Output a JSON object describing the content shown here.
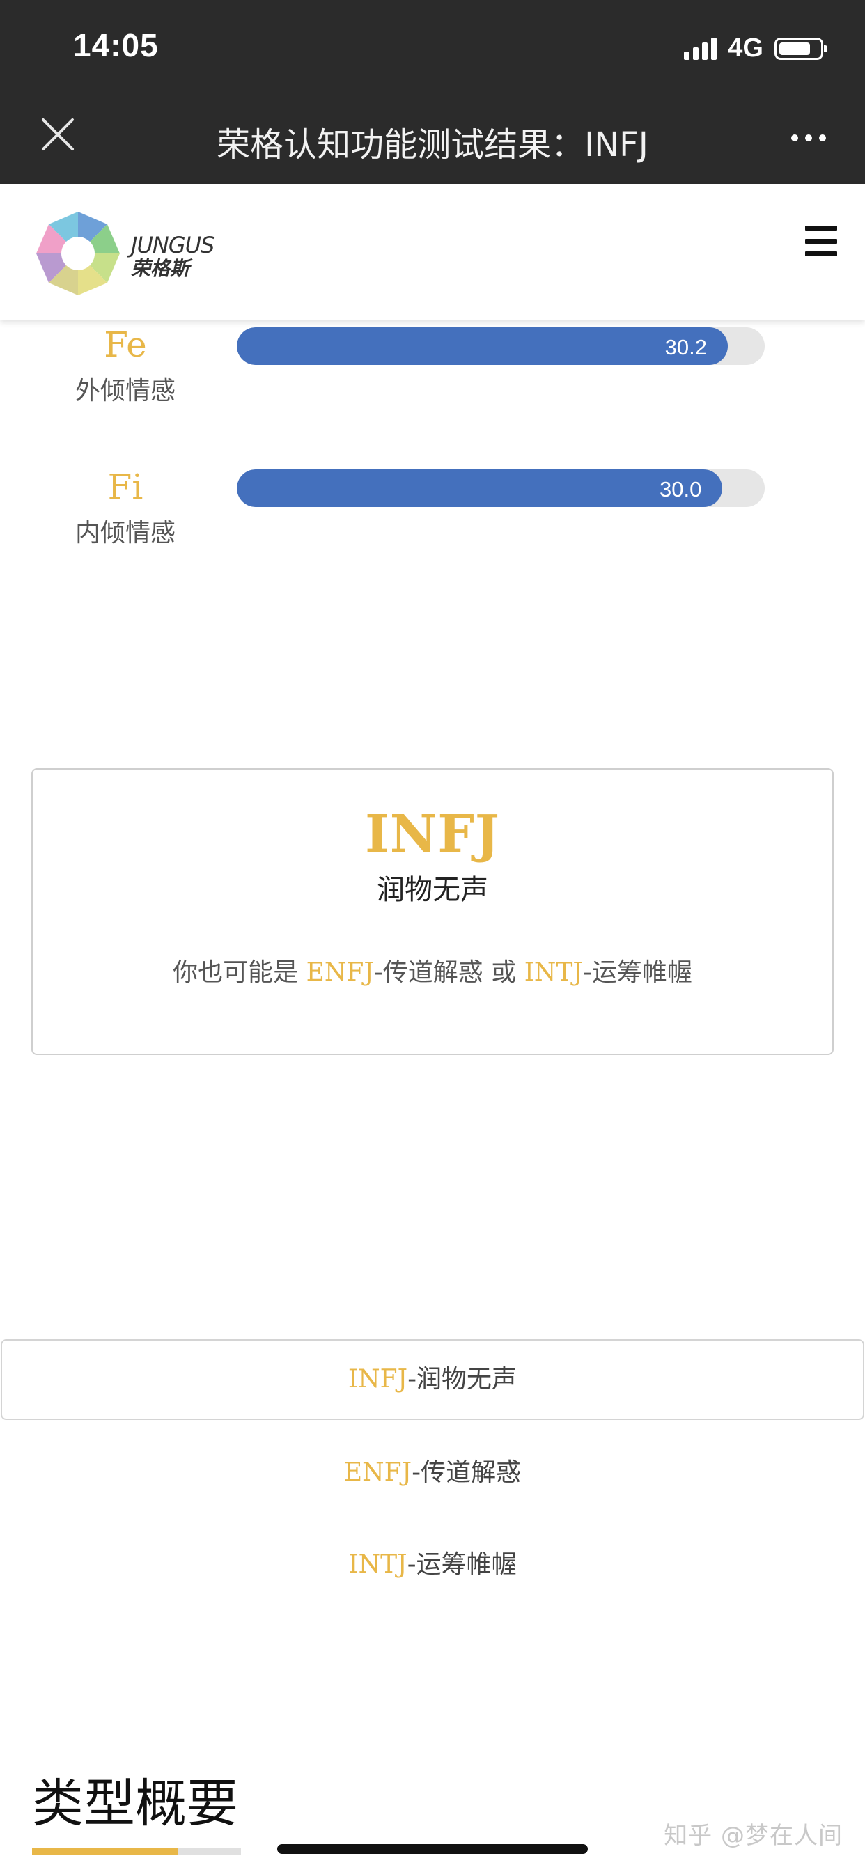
{
  "status_bar": {
    "time": "14:05",
    "network": "4G"
  },
  "nav": {
    "title": "荣格认知功能测试结果：INFJ"
  },
  "site": {
    "logo_en": "JUNGUS",
    "logo_zh": "荣格斯"
  },
  "functions": [
    {
      "code": "Fe",
      "name": "外倾情感",
      "value": "30.2",
      "percent": 93
    },
    {
      "code": "Fi",
      "name": "内倾情感",
      "value": "30.0",
      "percent": 92
    }
  ],
  "result": {
    "type": "INFJ",
    "name": "润物无声",
    "alt_prefix": "你也可能是",
    "alt1_code": "ENFJ",
    "alt1_name": "-传道解惑",
    "alt_or": "或",
    "alt2_code": "INTJ",
    "alt2_name": "-运筹帷幄"
  },
  "type_list": [
    {
      "code": "INFJ",
      "name": "-润物无声"
    },
    {
      "code": "ENFJ",
      "name": "-传道解惑"
    },
    {
      "code": "INTJ",
      "name": "-运筹帷幄"
    }
  ],
  "summary": {
    "title": "类型概要"
  },
  "watermark": "知乎 @梦在人间",
  "colors": {
    "gold": "#e8b748",
    "bar": "#4470bd",
    "track": "#e6e6e6",
    "topbar": "#2b2b2b"
  }
}
